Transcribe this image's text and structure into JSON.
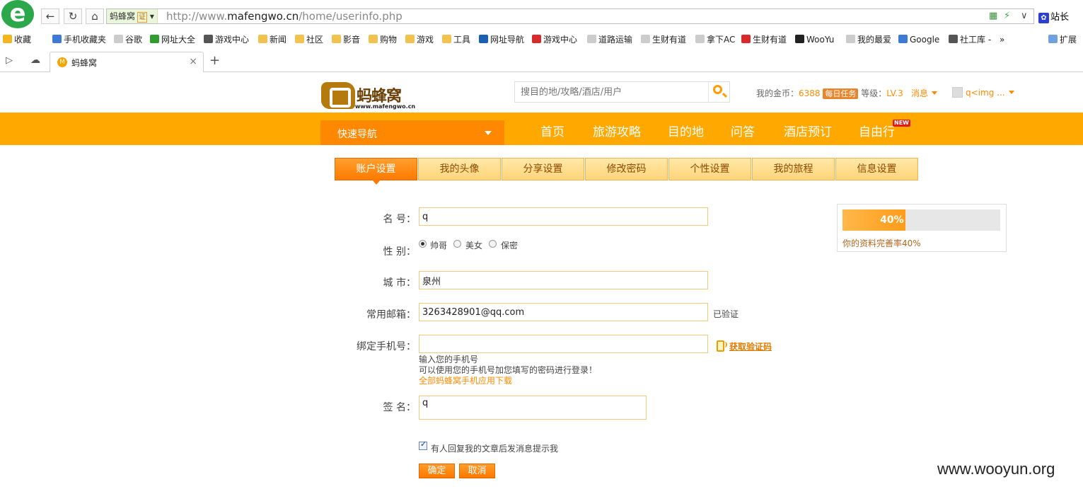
{
  "browser": {
    "site_badge": "蚂蜂窝",
    "cert_label": "证",
    "url_prefix": "http://www.",
    "url_host": "mafengwo.cn",
    "url_path": "/home/userinfo.php",
    "station_label": "站长",
    "bookmarks": [
      {
        "label": "收藏",
        "color": "#f3b61f"
      },
      {
        "label": "手机收藏夹",
        "color": "#3d7ad6"
      },
      {
        "label": "谷歌",
        "color": "#cccccc"
      },
      {
        "label": "网址大全",
        "color": "#2f9e2f"
      },
      {
        "label": "游戏中心",
        "color": "#555555"
      },
      {
        "label": "新闻",
        "color": "#f2c24f"
      },
      {
        "label": "社区",
        "color": "#f2c24f"
      },
      {
        "label": "影音",
        "color": "#f2c24f"
      },
      {
        "label": "购物",
        "color": "#f2c24f"
      },
      {
        "label": "游戏",
        "color": "#f2c24f"
      },
      {
        "label": "工具",
        "color": "#f2c24f"
      },
      {
        "label": "网址导航",
        "color": "#1a5fb4"
      },
      {
        "label": "游戏中心",
        "color": "#d92b2b"
      },
      {
        "label": "道路运输",
        "color": "#cccccc"
      },
      {
        "label": "生财有道",
        "color": "#cccccc"
      },
      {
        "label": "拿下AC",
        "color": "#cccccc"
      },
      {
        "label": "生财有道",
        "color": "#d92b2b"
      },
      {
        "label": "WooYu",
        "color": "#222222"
      },
      {
        "label": "我的最爱",
        "color": "#cccccc"
      },
      {
        "label": "Google",
        "color": "#3d7ad6"
      },
      {
        "label": "社工库 -",
        "color": "#555555"
      }
    ],
    "expand_label": "扩展",
    "tab_title": "蚂蜂窝",
    "tab_fav": "M"
  },
  "header": {
    "logo_cn": "蚂蜂窝",
    "logo_en": "www.mafengwo.cn",
    "search_placeholder": "搜目的地/攻略/酒店/用户",
    "coins_label": "我的金币：",
    "coins_value": "6388",
    "daily_task": "每日任务",
    "level_label": "等级：",
    "level_value": "LV.3",
    "messages": "消息",
    "username": "q<img ..."
  },
  "nav": {
    "quick_nav": "快速导航",
    "links": [
      "首页",
      "旅游攻略",
      "目的地",
      "问答",
      "酒店预订",
      "自由行"
    ],
    "new_badge": "NEW"
  },
  "tabs": [
    "账户设置",
    "我的头像",
    "分享设置",
    "修改密码",
    "个性设置",
    "我的旅程",
    "信息设置"
  ],
  "form": {
    "name_label": "名 号：",
    "name_value": "q",
    "gender_label": "性 别：",
    "gender_options": [
      "帅哥",
      "美女",
      "保密"
    ],
    "city_label": "城 市：",
    "city_value": "泉州",
    "email_label": "常用邮箱：",
    "email_value": "3263428901@qq.com",
    "email_status": "已验证",
    "phone_label": "绑定手机号：",
    "phone_value": "",
    "get_code": "获取验证码",
    "phone_hint1": "输入您的手机号",
    "phone_hint2": "可以使用您的手机号加您填写的密码进行登录！",
    "phone_hint3": "全部蚂蜂窝手机应用下载",
    "sign_label": "签 名：",
    "sign_value": "q",
    "notify_label": "有人回复我的文章后发消息提示我",
    "confirm": "确定",
    "cancel": "取消"
  },
  "progress": {
    "percent": 40,
    "percent_text": "40%",
    "label": "你的资料完善率40%"
  },
  "watermark": "www.wooyun.org"
}
